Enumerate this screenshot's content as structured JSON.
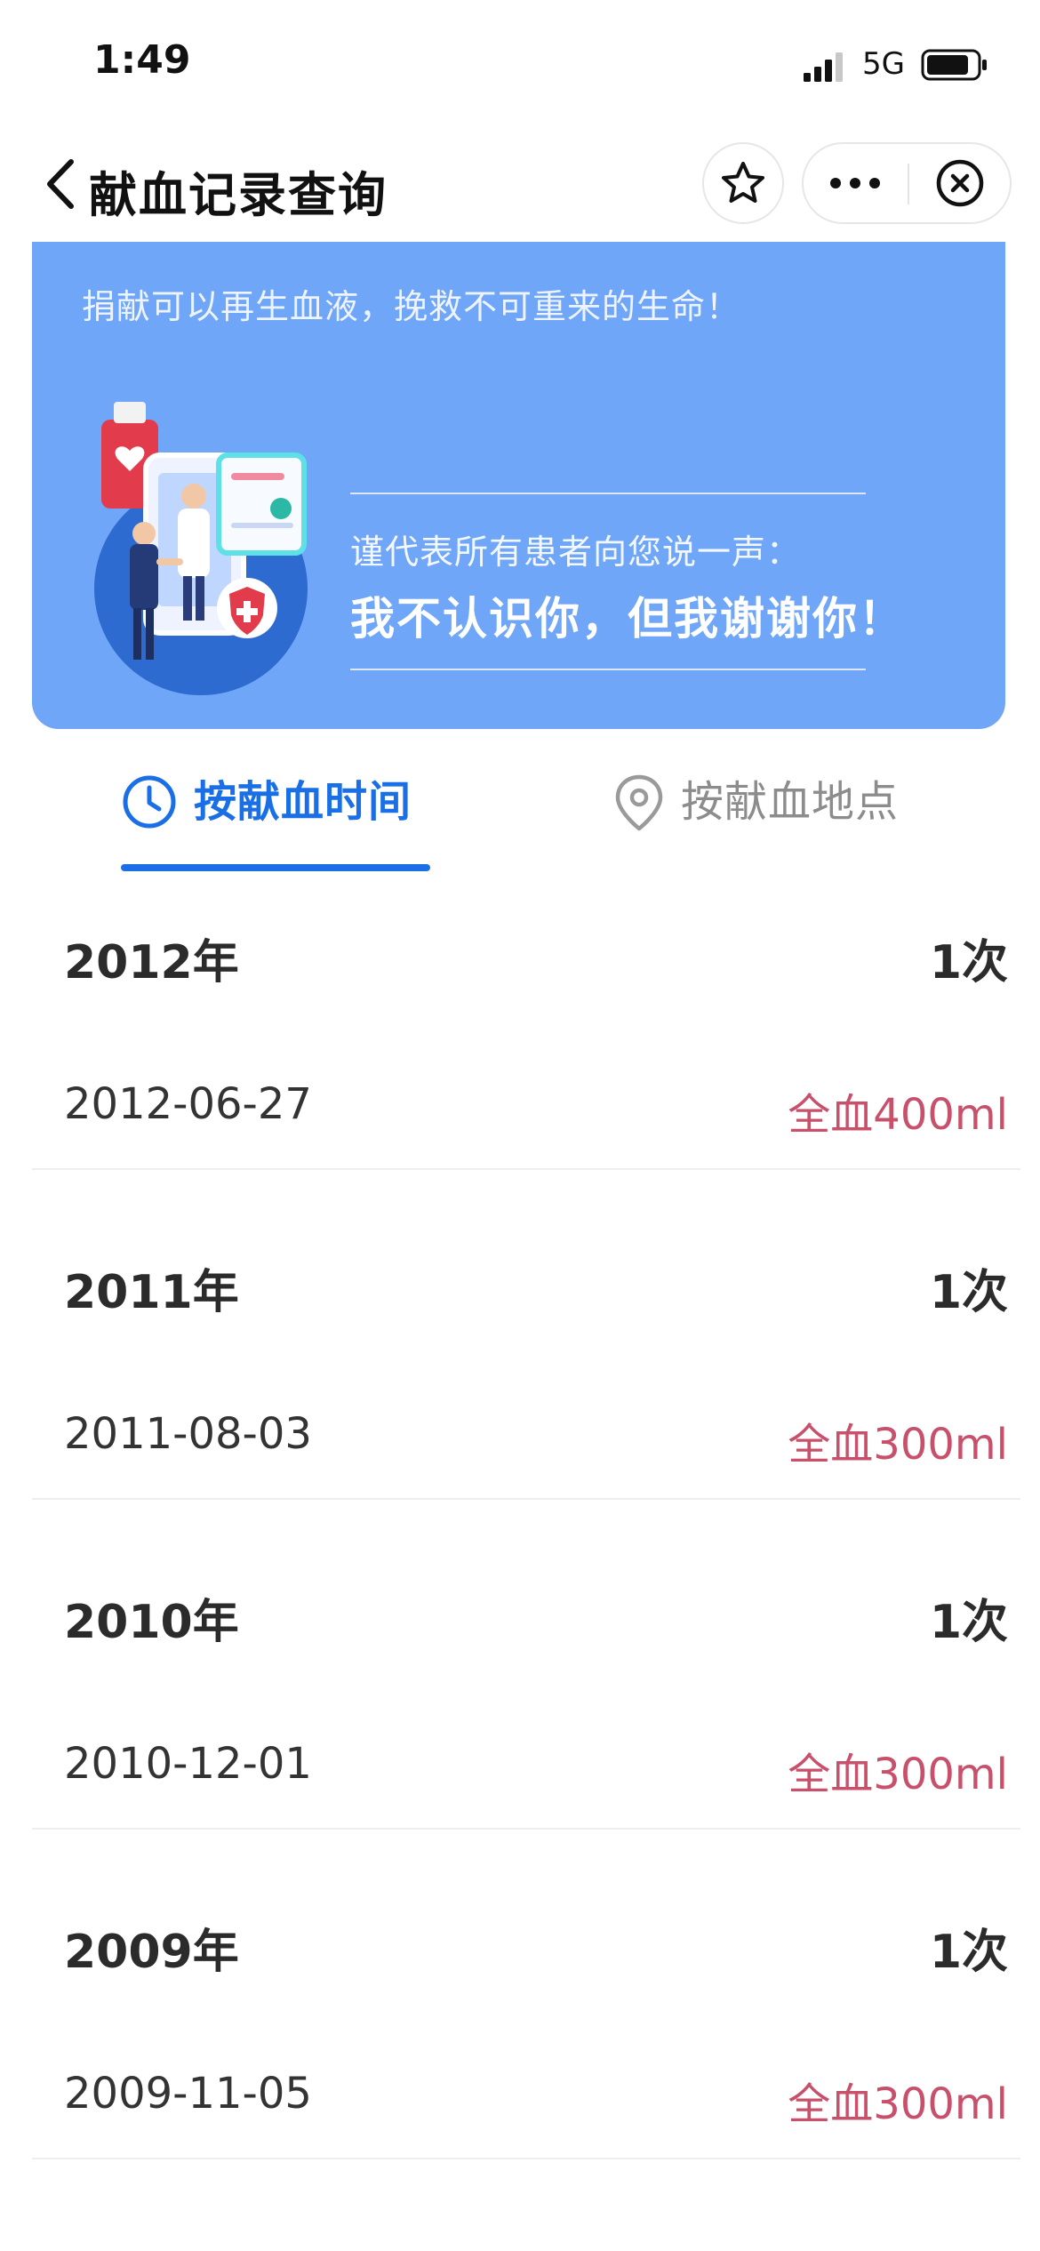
{
  "status_bar": {
    "time": "1:49",
    "network": "5G"
  },
  "nav": {
    "title": "献血记录查询"
  },
  "banner": {
    "slogan": "捐献可以再生血液，挽救不可重来的生命！",
    "thanks_sub": "谨代表所有患者向您说一声：",
    "thanks_main": "我不认识你，但我谢谢你！"
  },
  "tabs": [
    {
      "label": "按献血时间",
      "icon": "clock-icon",
      "active": true
    },
    {
      "label": "按献血地点",
      "icon": "location-pin-icon",
      "active": false
    }
  ],
  "records": [
    {
      "year": "2012年",
      "count": "1次",
      "date": "2012-06-27",
      "amount": "全血400ml"
    },
    {
      "year": "2011年",
      "count": "1次",
      "date": "2011-08-03",
      "amount": "全血300ml"
    },
    {
      "year": "2010年",
      "count": "1次",
      "date": "2010-12-01",
      "amount": "全血300ml"
    },
    {
      "year": "2009年",
      "count": "1次",
      "date": "2009-11-05",
      "amount": "全血300ml"
    }
  ],
  "colors": {
    "accent": "#1a6fe6",
    "banner": "#70a6f7",
    "amount": "#c8506b",
    "inactive_tab": "#8c8c8c"
  }
}
